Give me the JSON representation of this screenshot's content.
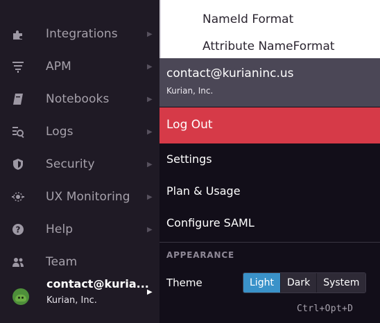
{
  "sidebar": {
    "items": [
      {
        "label": "Integrations",
        "icon": "puzzle-icon"
      },
      {
        "label": "APM",
        "icon": "apm-icon"
      },
      {
        "label": "Notebooks",
        "icon": "notebook-icon"
      },
      {
        "label": "Logs",
        "icon": "logs-icon"
      },
      {
        "label": "Security",
        "icon": "shield-icon"
      },
      {
        "label": "UX Monitoring",
        "icon": "ux-monitoring-icon"
      },
      {
        "label": "Help",
        "icon": "help-icon"
      },
      {
        "label": "Team",
        "icon": "team-icon"
      }
    ],
    "user": {
      "email": "contact@kuria...",
      "org": "Kurian, Inc.",
      "avatar_icon": "dog-avatar-icon"
    }
  },
  "background_panel": {
    "rows": [
      "NameId Format",
      "Attribute NameFormat"
    ]
  },
  "account_menu": {
    "email": "contact@kurianinc.us",
    "org": "Kurian, Inc.",
    "logout_label": "Log Out",
    "items": [
      "Settings",
      "Plan & Usage",
      "Configure SAML"
    ],
    "appearance_title": "APPEARANCE",
    "theme_label": "Theme",
    "theme_options": [
      "Light",
      "Dark",
      "System"
    ],
    "theme_selected": "Light",
    "shortcut": "Ctrl+Opt+D"
  },
  "colors": {
    "sidebar_bg": "#1f1a25",
    "menu_bg": "#120e19",
    "header_bg": "#4b4756",
    "logout_bg": "#d63a48",
    "accent": "#3a92c9"
  }
}
